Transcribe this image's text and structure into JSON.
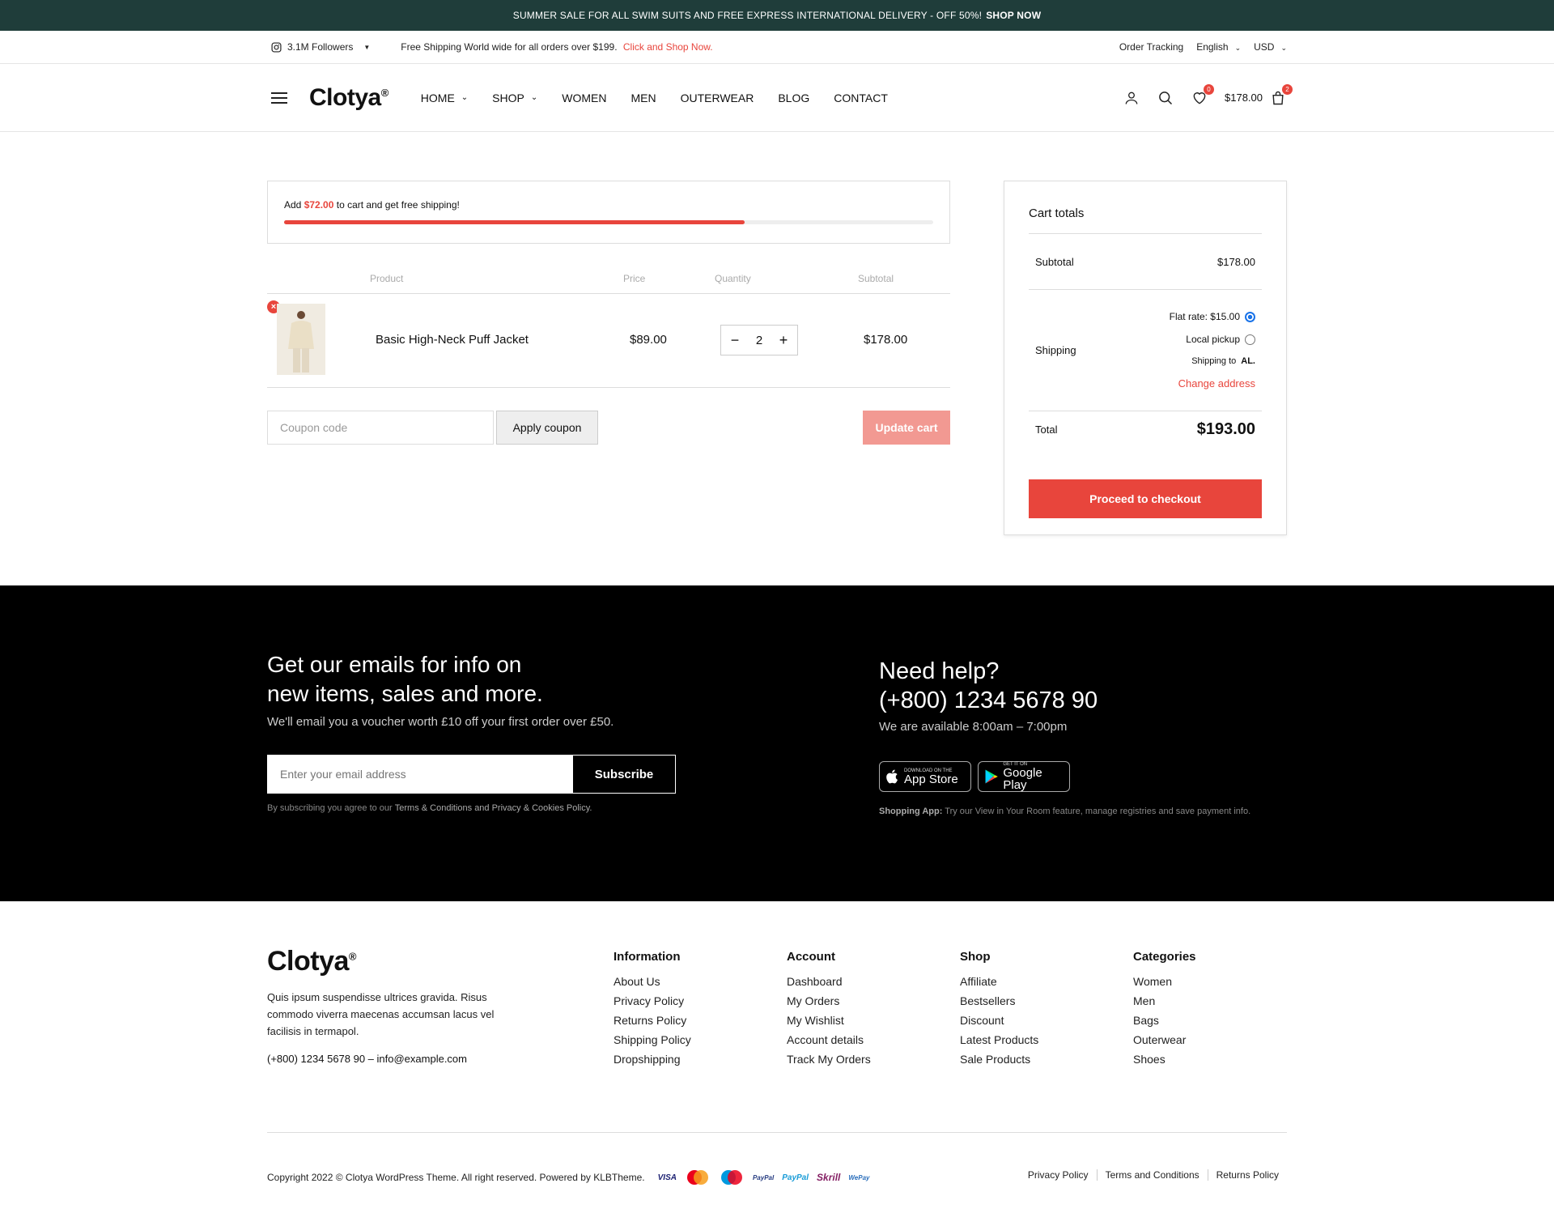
{
  "topbar": {
    "text": "SUMMER SALE FOR ALL SWIM SUITS AND FREE EXPRESS INTERNATIONAL DELIVERY - OFF 50%!",
    "cta": "SHOP NOW"
  },
  "utility": {
    "followers": "3.1M Followers",
    "free_shipping": "Free Shipping World wide for all orders over $199.",
    "free_shipping_link": "Click and Shop Now.",
    "order_tracking": "Order Tracking",
    "language": "English",
    "currency": "USD"
  },
  "header": {
    "logo": "Clotya",
    "nav": [
      "HOME",
      "SHOP",
      "WOMEN",
      "MEN",
      "OUTERWEAR",
      "BLOG",
      "CONTACT"
    ],
    "wishlist_count": "0",
    "cart_total": "$178.00",
    "cart_count": "2"
  },
  "free_shipping_bar": {
    "prefix": "Add",
    "amount": "$72.00",
    "suffix": "to cart and get free shipping!",
    "progress": 0.71
  },
  "cart": {
    "headers": [
      "Product",
      "Price",
      "Quantity",
      "Subtotal"
    ],
    "item": {
      "name": "Basic High-Neck Puff Jacket",
      "price": "$89.00",
      "quantity": "2",
      "subtotal": "$178.00"
    },
    "coupon_placeholder": "Coupon code",
    "apply_label": "Apply coupon",
    "update_label": "Update cart"
  },
  "totals": {
    "title": "Cart totals",
    "subtotal_label": "Subtotal",
    "subtotal": "$178.00",
    "shipping_label": "Shipping",
    "flat_rate": "Flat rate: $15.00",
    "local_pickup": "Local pickup",
    "shipping_to": "Shipping to",
    "shipping_to_country": "AL.",
    "change_address": "Change address",
    "total_label": "Total",
    "total": "$193.00",
    "checkout_label": "Proceed to checkout"
  },
  "newsletter": {
    "title_line1": "Get our emails for info on",
    "title_line2": "new items, sales and more.",
    "subtitle": "We'll email you a voucher worth £10 off your first order over £50.",
    "email_placeholder": "Enter your email address",
    "subscribe_label": "Subscribe",
    "note_prefix": "By subscribing you agree to our",
    "note_link": "Terms & Conditions and Privacy & Cookies Policy."
  },
  "help": {
    "title": "Need help?",
    "phone": "(+800) 1234 5678 90",
    "availability": "We are available 8:00am – 7:00pm",
    "app_store_small": "DOWNLOAD ON THE",
    "app_store": "App Store",
    "google_play_small": "GET IT ON",
    "google_play": "Google Play",
    "app_note_label": "Shopping App:",
    "app_note": "Try our View in Your Room feature, manage registries and save payment info."
  },
  "footer": {
    "logo": "Clotya",
    "description": "Quis ipsum suspendisse ultrices gravida. Risus commodo viverra maecenas accumsan lacus vel facilisis in termapol.",
    "contact": "(+800) 1234 5678 90 – info@example.com",
    "columns": [
      {
        "title": "Information",
        "links": [
          "About Us",
          "Privacy Policy",
          "Returns Policy",
          "Shipping Policy",
          "Dropshipping"
        ]
      },
      {
        "title": "Account",
        "links": [
          "Dashboard",
          "My Orders",
          "My Wishlist",
          "Account details",
          "Track My Orders"
        ]
      },
      {
        "title": "Shop",
        "links": [
          "Affiliate",
          "Bestsellers",
          "Discount",
          "Latest Products",
          "Sale Products"
        ]
      },
      {
        "title": "Categories",
        "links": [
          "Women",
          "Men",
          "Bags",
          "Outerwear",
          "Shoes"
        ]
      }
    ],
    "copyright": "Copyright 2022 © Clotya WordPress Theme. All right reserved. Powered by KLBTheme.",
    "payments": [
      "VISA",
      "Mastercard",
      "Maestro",
      "PayPal",
      "PayPal",
      "Skrill",
      "WePay"
    ],
    "legal": [
      "Privacy Policy",
      "Terms and Conditions",
      "Returns Policy"
    ]
  },
  "colors": {
    "accent": "#e8453c",
    "topbar": "#1f3d3a",
    "newsletter_bg": "#000000"
  }
}
